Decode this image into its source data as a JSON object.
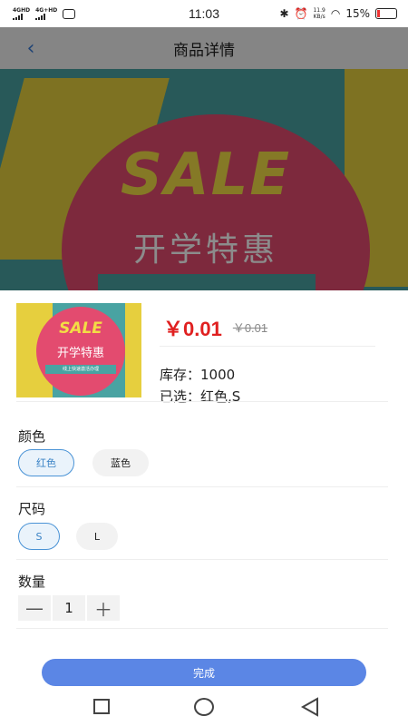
{
  "status_bar": {
    "network_1": "4GHD",
    "network_2": "4G+HD",
    "time": "11:03",
    "speed_value": "11.9",
    "speed_unit": "KB/s",
    "battery": "15%",
    "battery_level_percent": 15
  },
  "header": {
    "title": "商品详情"
  },
  "hero_image": {
    "sale_text": "SALE",
    "promo_text": "开学特惠"
  },
  "product": {
    "thumb_sale": "SALE",
    "thumb_promo": "开学特惠",
    "thumb_strip": "线上快速激活办理",
    "price": "￥0.01",
    "original_price": "￥0.01",
    "stock": "库存：1000",
    "selected": "已选：红色,S"
  },
  "color_section": {
    "title": "颜色",
    "options": [
      "红色",
      "蓝色"
    ],
    "selected": "红色"
  },
  "size_section": {
    "title": "尺码",
    "options": [
      "S",
      "L"
    ],
    "selected": "S"
  },
  "quantity_section": {
    "title": "数量",
    "value": "1",
    "minus": "—",
    "plus": "＋"
  },
  "done_button": {
    "label": "完成"
  },
  "colors": {
    "accent": "#5b86e5",
    "price": "#e02020",
    "selected_border": "#4a93d6"
  }
}
